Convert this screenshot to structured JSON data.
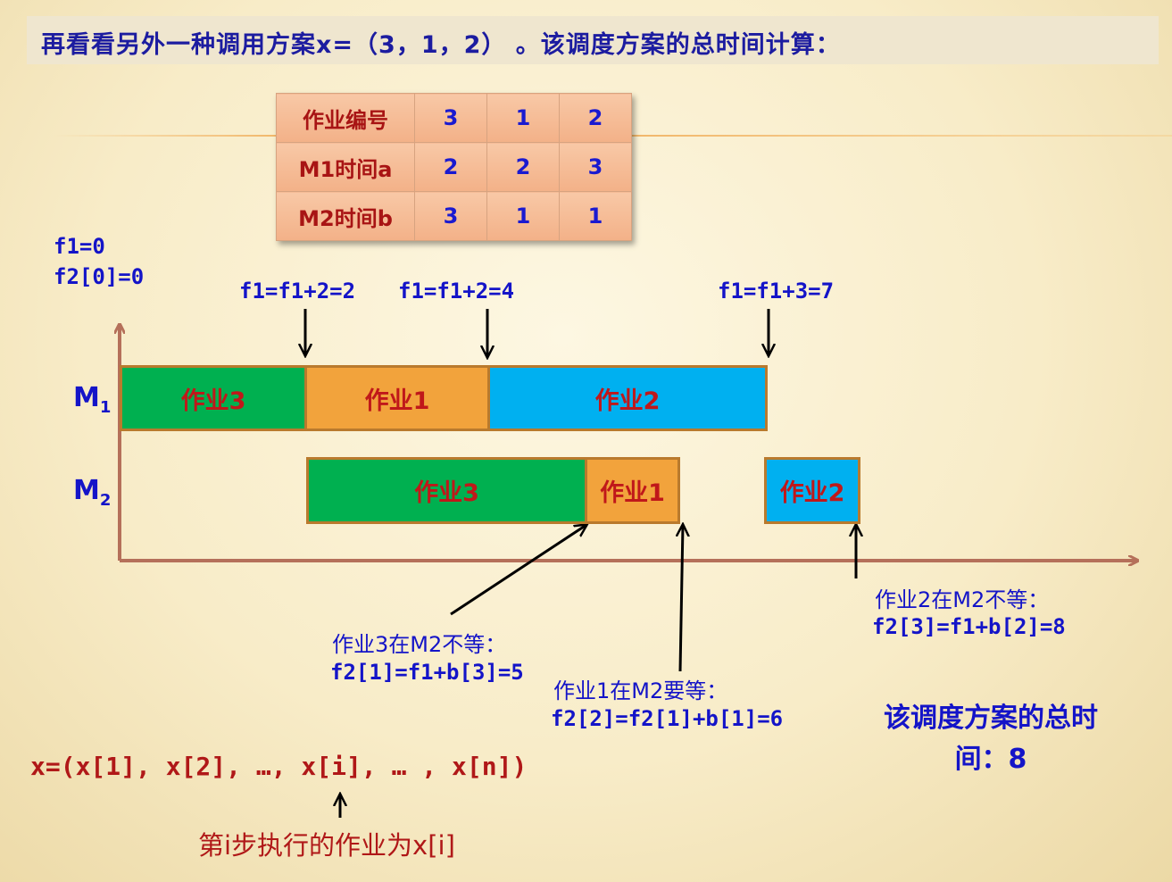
{
  "title": "再看看另外一种调用方案x=（3，1，2） 。该调度方案的总时间计算：",
  "table": {
    "rows": [
      {
        "header": "作业编号",
        "values": [
          "3",
          "1",
          "2"
        ]
      },
      {
        "header": "M1时间a",
        "values": [
          "2",
          "2",
          "3"
        ]
      },
      {
        "header": "M2时间b",
        "values": [
          "3",
          "1",
          "1"
        ]
      }
    ]
  },
  "init": {
    "f1": "f1=0",
    "f2": "f2[0]=0"
  },
  "m1_annotations": [
    "f1=f1+2=2",
    "f1=f1+2=4",
    "f1=f1+3=7"
  ],
  "machines": {
    "m1": "M1",
    "m2": "M2"
  },
  "m1_jobs": [
    "作业3",
    "作业1",
    "作业2"
  ],
  "m2_jobs": [
    "作业3",
    "作业1",
    "作业2"
  ],
  "notes": [
    {
      "line1": "作业3在M2不等：",
      "line2": "f2[1]=f1+b[3]=5"
    },
    {
      "line1": "作业1在M2要等：",
      "line2": "f2[2]=f2[1]+b[1]=6"
    },
    {
      "line1": "作业2在M2不等：",
      "line2": "f2[3]=f1+b[2]=8"
    }
  ],
  "total": "该调度方案的总时间：8",
  "sequence": "x=(x[1], x[2], …, x[i],  … , x[n])",
  "step": "第i步执行的作业为x[i]",
  "colors": {
    "job3": "#00b050",
    "job1": "#f2a33c",
    "job2": "#00b0f0",
    "axis": "#b5705a",
    "text_blue": "#1414c8",
    "text_red": "#b01818"
  }
}
